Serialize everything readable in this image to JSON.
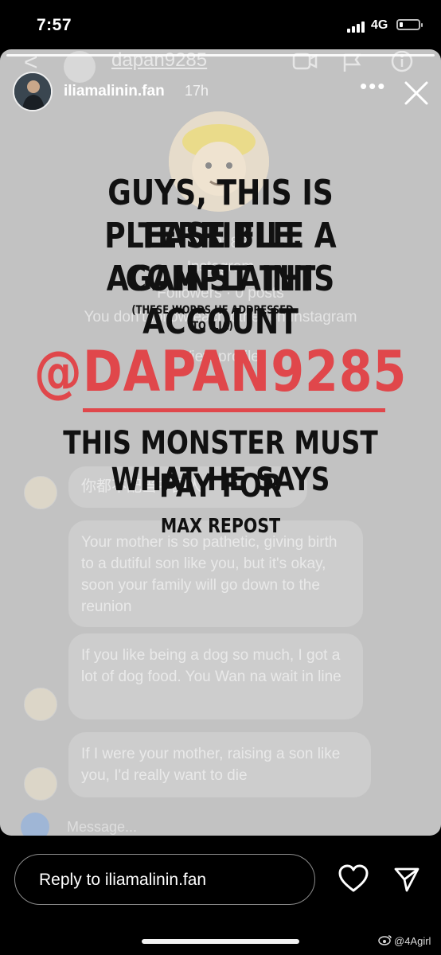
{
  "status_bar": {
    "time": "7:57",
    "network": "4G",
    "battery_level": 0.2
  },
  "background_screenshot": {
    "handle": "dapan9285",
    "profile_lines": [
      "lan9285",
      "Instagram",
      "Followers · 0 posts",
      "You don't follow each other on Instagram",
      "View profile"
    ],
    "chinese_message": "你都不配当中国人",
    "messages": [
      "Your mother is so pathetic, giving birth to a dutiful son like you, but it's okay, soon your family will go down to the reunion",
      "If you like being a dog so much, I got a lot of dog food. You Wan na wait in line",
      "If I were your mother, raising a son like you, I'd really want to die"
    ],
    "message_placeholder": "Message..."
  },
  "story_header": {
    "username": "iliamalinin.fan",
    "time_ago": "17h"
  },
  "overlay": {
    "line1": "GUYS, THIS IS TERRIBLE.",
    "line2": "PLEASE FILE A COMPLAINT",
    "line3": "AGAINST THIS ACCOUNT",
    "note_line1": "(THESE WORDS HE ADDRESSED",
    "note_line2": "TO ILIA)",
    "handle": "@DAPAN9285",
    "line4": "THIS MONSTER MUST PAY FOR",
    "line5": "WHAT HE SAYS",
    "line6": "MAX REPOST"
  },
  "reply_bar": {
    "placeholder": "Reply to iliamalinin.fan"
  },
  "watermark": "@4Agirl",
  "icons": [
    "signal-icon",
    "battery-icon",
    "back-arrow-icon",
    "video-call-icon",
    "flag-icon",
    "info-icon",
    "more-icon",
    "close-icon",
    "camera-icon",
    "heart-icon",
    "send-icon",
    "weibo-logo-icon"
  ]
}
